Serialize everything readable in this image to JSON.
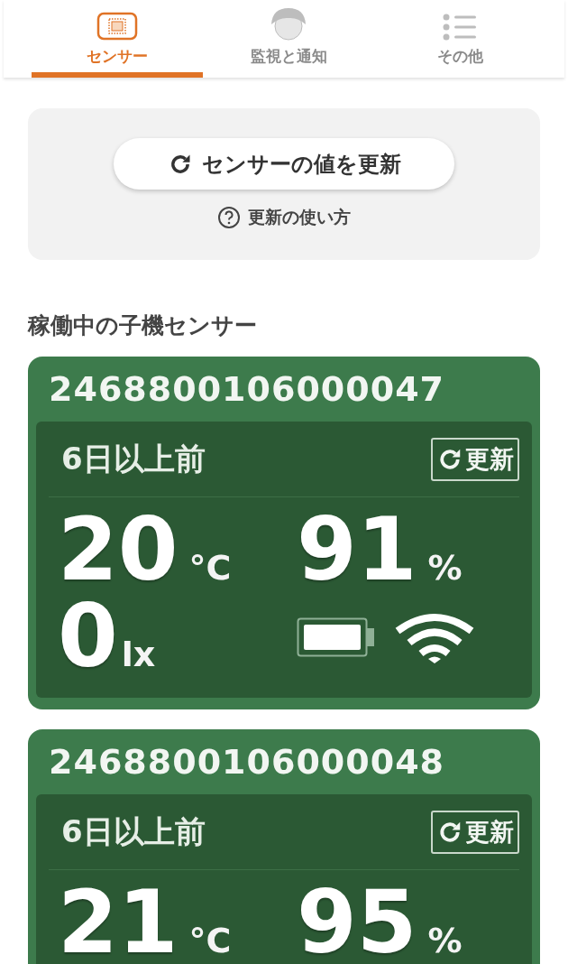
{
  "tabs": [
    {
      "label": "センサー",
      "kind": "chip",
      "selected": true
    },
    {
      "label": "監視と通知",
      "kind": "mascot",
      "selected": false
    },
    {
      "label": "その他",
      "kind": "list",
      "selected": false
    }
  ],
  "refresh_panel": {
    "button": "センサーの値を更新",
    "help_link": "更新の使い方"
  },
  "section_title": "稼働中の子機センサー",
  "sensors": [
    {
      "id": "2468800106000047",
      "updated": "6日以上前",
      "refresh_button": "更新",
      "temperature": "20",
      "temperature_unit": "°C",
      "humidity": "91",
      "humidity_unit": "%",
      "lux": "0",
      "lux_unit": "lx"
    },
    {
      "id": "2468800106000048",
      "updated": "6日以上前",
      "refresh_button": "更新",
      "temperature": "21",
      "temperature_unit": "°C",
      "humidity": "95",
      "humidity_unit": "%"
    }
  ]
}
